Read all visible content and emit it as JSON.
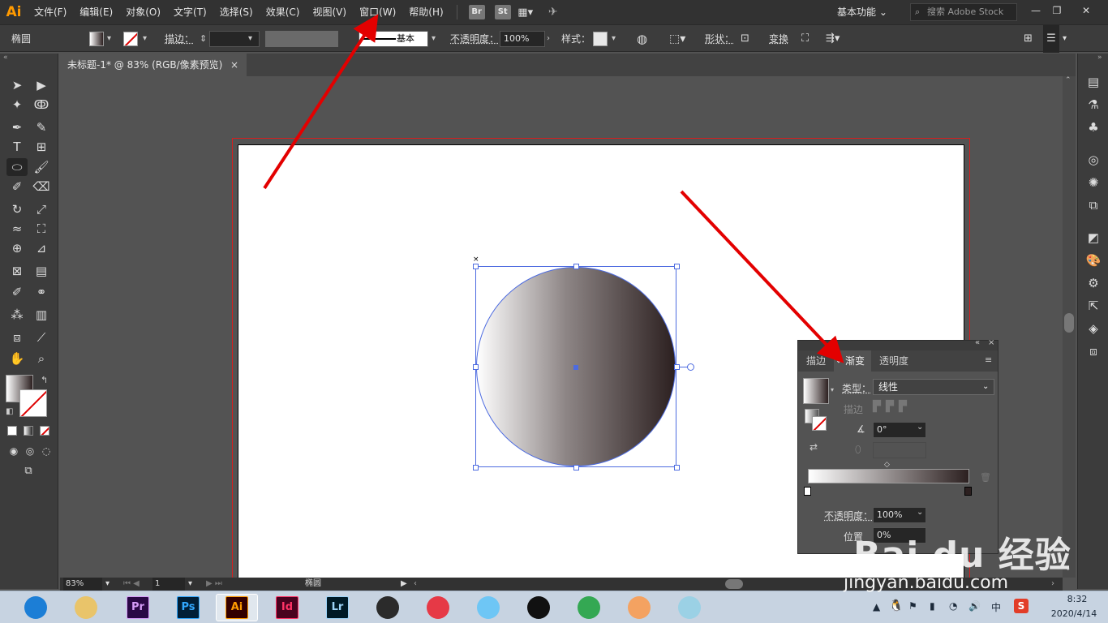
{
  "app": {
    "logo": "Ai"
  },
  "menu": [
    "文件(F)",
    "编辑(E)",
    "对象(O)",
    "文字(T)",
    "选择(S)",
    "效果(C)",
    "视图(V)",
    "窗口(W)",
    "帮助(H)"
  ],
  "menu_badges": [
    "Br",
    "St"
  ],
  "workspace": "基本功能",
  "search_placeholder": "搜索 Adobe Stock",
  "window_controls": [
    "—",
    "❐",
    "✕"
  ],
  "control_bar": {
    "object_type": "椭圆",
    "stroke_label": "描边：",
    "stroke_profile": "基本",
    "opacity_label": "不透明度：",
    "opacity_value": "100%",
    "style_label": "样式：",
    "shape_label": "形状：",
    "transform_label": "变换"
  },
  "document_tab": {
    "title": "未标题-1* @ 83% (RGB/像素预览)",
    "close": "×"
  },
  "status_bar": {
    "zoom": "83%",
    "page": "1",
    "tool_name": "椭圆"
  },
  "gradient_panel": {
    "tabs": [
      "描边",
      "渐变",
      "透明度"
    ],
    "type_label": "类型：",
    "type_value": "线性",
    "stroke_label": "描边",
    "angle_value": "0°",
    "opacity_label": "不透明度：",
    "opacity_value": "100%",
    "location_label": "位置",
    "location_value": "0%",
    "start_color": "#ffffff",
    "end_color": "#2c2020"
  },
  "taskbar": {
    "apps": [
      {
        "name": "360-browser",
        "label": "",
        "color": "#1c7ed6"
      },
      {
        "name": "file-explorer",
        "label": "",
        "color": "#e9c46a"
      },
      {
        "name": "premiere",
        "label": "Pr",
        "color": "#2a0845"
      },
      {
        "name": "photoshop",
        "label": "Ps",
        "color": "#001e36"
      },
      {
        "name": "illustrator",
        "label": "Ai",
        "color": "#330000"
      },
      {
        "name": "indesign",
        "label": "Id",
        "color": "#49021f"
      },
      {
        "name": "lightroom",
        "label": "Lr",
        "color": "#001a26"
      },
      {
        "name": "video-editor",
        "label": "",
        "color": "#2b2b2b"
      },
      {
        "name": "umbrella-app",
        "label": "",
        "color": "#e63946"
      },
      {
        "name": "rabbit-app",
        "label": "",
        "color": "#6ec6f5"
      },
      {
        "name": "qq",
        "label": "",
        "color": "#111111"
      },
      {
        "name": "chrome",
        "label": "",
        "color": "#34a853"
      },
      {
        "name": "fox-app",
        "label": "",
        "color": "#f4a261"
      },
      {
        "name": "notebook-app",
        "label": "",
        "color": "#9bd1e5"
      }
    ],
    "tray_ime": "中",
    "time": "8:32",
    "date": "2020/4/14"
  },
  "watermark": {
    "line1": "Bai du 经验",
    "line2": "jingyan.baidu.com"
  },
  "colors": {
    "accent": "#ff9a00",
    "annotation": "#e30000",
    "selection": "#4d6be0"
  }
}
